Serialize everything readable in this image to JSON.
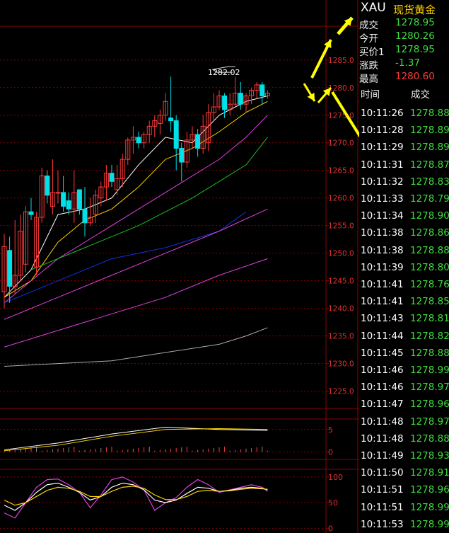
{
  "quote_panel": {
    "symbol": "XAU",
    "name": "现货黄金",
    "rows": [
      {
        "label": "成交",
        "value": "1278.95",
        "color": "green"
      },
      {
        "label": "今开",
        "value": "1280.26",
        "color": "green"
      },
      {
        "label": "买价1",
        "value": "1278.95",
        "color": "green"
      },
      {
        "label": "涨跌",
        "value": "-1.37",
        "color": "green"
      },
      {
        "label": "最高",
        "value": "1280.60",
        "color": "red"
      }
    ]
  },
  "ticks": {
    "header_time": "时间",
    "header_price": "成交",
    "rows": [
      {
        "time": "10:11:26",
        "price": "1278.88"
      },
      {
        "time": "10:11:28",
        "price": "1278.89"
      },
      {
        "time": "10:11:29",
        "price": "1278.89"
      },
      {
        "time": "10:11:31",
        "price": "1278.87"
      },
      {
        "time": "10:11:32",
        "price": "1278.83"
      },
      {
        "time": "10:11:33",
        "price": "1278.79"
      },
      {
        "time": "10:11:34",
        "price": "1278.90"
      },
      {
        "time": "10:11:38",
        "price": "1278.86"
      },
      {
        "time": "10:11:38",
        "price": "1278.88"
      },
      {
        "time": "10:11:39",
        "price": "1278.80"
      },
      {
        "time": "10:11:41",
        "price": "1278.76"
      },
      {
        "time": "10:11:41",
        "price": "1278.85"
      },
      {
        "time": "10:11:43",
        "price": "1278.81"
      },
      {
        "time": "10:11:44",
        "price": "1278.82"
      },
      {
        "time": "10:11:45",
        "price": "1278.88"
      },
      {
        "time": "10:11:46",
        "price": "1278.99"
      },
      {
        "time": "10:11:46",
        "price": "1278.97"
      },
      {
        "time": "10:11:47",
        "price": "1278.96"
      },
      {
        "time": "10:11:48",
        "price": "1278.97"
      },
      {
        "time": "10:11:48",
        "price": "1278.88"
      },
      {
        "time": "10:11:49",
        "price": "1278.93"
      },
      {
        "time": "10:11:50",
        "price": "1278.91"
      },
      {
        "time": "10:11:51",
        "price": "1278.96"
      },
      {
        "time": "10:11:51",
        "price": "1278.99"
      },
      {
        "time": "10:11:53",
        "price": "1278.99"
      }
    ]
  },
  "colors": {
    "up": "#ff3a3a",
    "down": "#00e0e8",
    "grid": "#8c0000",
    "axis_text": "#e03030",
    "ma5": "#ffffff",
    "ma10": "#ffd200",
    "ma20": "#e040e0",
    "ma30": "#20c020",
    "ma60": "#1030e0",
    "annotation_arrow": "#ffff00"
  },
  "chart_data": [
    {
      "type": "candlestick",
      "ylim": [
        1222,
        1291
      ],
      "y_tick_labels": [
        "1285.0",
        "1280.0",
        "1275.0",
        "1270.0",
        "1265.0",
        "1260.0",
        "1255.0",
        "1250.0",
        "1245.0",
        "1240.0",
        "1235.0",
        "1230.0",
        "1225.0"
      ],
      "y_ticks": [
        1285,
        1280,
        1275,
        1270,
        1265,
        1260,
        1255,
        1250,
        1245,
        1240,
        1235,
        1230,
        1225
      ],
      "high_label": "1282.02",
      "candles": [
        {
          "o": 1243,
          "h": 1253.5,
          "l": 1240,
          "c": 1251.2
        },
        {
          "o": 1250.5,
          "h": 1253,
          "l": 1241,
          "c": 1244
        },
        {
          "o": 1244,
          "h": 1256,
          "l": 1242.5,
          "c": 1246
        },
        {
          "o": 1246,
          "h": 1257,
          "l": 1245,
          "c": 1254
        },
        {
          "o": 1248,
          "h": 1258.5,
          "l": 1246.5,
          "c": 1257.5
        },
        {
          "o": 1257.5,
          "h": 1260,
          "l": 1256,
          "c": 1257
        },
        {
          "o": 1247.5,
          "h": 1257.5,
          "l": 1246,
          "c": 1256.5
        },
        {
          "o": 1256.5,
          "h": 1265.5,
          "l": 1255.5,
          "c": 1264
        },
        {
          "o": 1264,
          "h": 1265,
          "l": 1259,
          "c": 1260.5
        },
        {
          "o": 1258.5,
          "h": 1267,
          "l": 1257,
          "c": 1261
        },
        {
          "o": 1261,
          "h": 1265,
          "l": 1259,
          "c": 1261
        },
        {
          "o": 1261,
          "h": 1264,
          "l": 1257.5,
          "c": 1258.5
        },
        {
          "o": 1259.5,
          "h": 1261,
          "l": 1257,
          "c": 1258
        },
        {
          "o": 1258,
          "h": 1265,
          "l": 1255.5,
          "c": 1261
        },
        {
          "o": 1261.5,
          "h": 1261,
          "l": 1257,
          "c": 1258
        },
        {
          "o": 1258,
          "h": 1262,
          "l": 1253,
          "c": 1255.5
        },
        {
          "o": 1255.5,
          "h": 1260,
          "l": 1255,
          "c": 1256.5
        },
        {
          "o": 1257,
          "h": 1261.5,
          "l": 1255.5,
          "c": 1260.5
        },
        {
          "o": 1260,
          "h": 1263,
          "l": 1258.5,
          "c": 1262
        },
        {
          "o": 1262,
          "h": 1266,
          "l": 1259.5,
          "c": 1264.5
        },
        {
          "o": 1264.5,
          "h": 1266,
          "l": 1262,
          "c": 1263
        },
        {
          "o": 1261.5,
          "h": 1266,
          "l": 1260.5,
          "c": 1263.5
        },
        {
          "o": 1263.5,
          "h": 1268,
          "l": 1262,
          "c": 1267
        },
        {
          "o": 1267,
          "h": 1271,
          "l": 1266,
          "c": 1270.5
        },
        {
          "o": 1270.5,
          "h": 1273,
          "l": 1268,
          "c": 1271
        },
        {
          "o": 1271,
          "h": 1272,
          "l": 1269,
          "c": 1270
        },
        {
          "o": 1270,
          "h": 1272,
          "l": 1269,
          "c": 1271.5
        },
        {
          "o": 1271.5,
          "h": 1274,
          "l": 1270,
          "c": 1273
        },
        {
          "o": 1273,
          "h": 1275,
          "l": 1271,
          "c": 1274
        },
        {
          "o": 1273.5,
          "h": 1276,
          "l": 1271.5,
          "c": 1275
        },
        {
          "o": 1275,
          "h": 1279,
          "l": 1274,
          "c": 1277.5
        },
        {
          "o": 1274.5,
          "h": 1282,
          "l": 1272,
          "c": 1274
        },
        {
          "o": 1274,
          "h": 1275,
          "l": 1265,
          "c": 1269
        },
        {
          "o": 1269,
          "h": 1270,
          "l": 1263,
          "c": 1266.5
        },
        {
          "o": 1266.5,
          "h": 1272,
          "l": 1265.5,
          "c": 1270.5
        },
        {
          "o": 1270.5,
          "h": 1273,
          "l": 1269,
          "c": 1271.5
        },
        {
          "o": 1271.5,
          "h": 1272.5,
          "l": 1267.5,
          "c": 1269
        },
        {
          "o": 1269,
          "h": 1275,
          "l": 1268,
          "c": 1273
        },
        {
          "o": 1270,
          "h": 1277,
          "l": 1268.5,
          "c": 1275.5
        },
        {
          "o": 1275.5,
          "h": 1279,
          "l": 1274,
          "c": 1276.5
        },
        {
          "o": 1276.5,
          "h": 1279.5,
          "l": 1276,
          "c": 1278.5
        },
        {
          "o": 1278.5,
          "h": 1279,
          "l": 1274.5,
          "c": 1276
        },
        {
          "o": 1276,
          "h": 1279,
          "l": 1275,
          "c": 1277
        },
        {
          "o": 1277,
          "h": 1282,
          "l": 1276.5,
          "c": 1279
        },
        {
          "o": 1279,
          "h": 1281,
          "l": 1276,
          "c": 1277
        },
        {
          "o": 1277,
          "h": 1279,
          "l": 1275.5,
          "c": 1278.5
        },
        {
          "o": 1278.5,
          "h": 1280,
          "l": 1277,
          "c": 1279.5
        },
        {
          "o": 1279.5,
          "h": 1281,
          "l": 1278,
          "c": 1280.5
        },
        {
          "o": 1280.5,
          "h": 1281,
          "l": 1277,
          "c": 1278.5
        },
        {
          "o": 1278.5,
          "h": 1279.5,
          "l": 1278,
          "c": 1279
        }
      ],
      "moving_averages": [
        {
          "color": "ma5",
          "x": [
            0,
            5,
            10,
            15,
            20,
            25,
            30,
            35,
            40,
            45,
            49
          ],
          "y": [
            1242,
            1247,
            1257,
            1258,
            1260,
            1266,
            1271,
            1270,
            1275,
            1277.5,
            1278.5
          ]
        },
        {
          "color": "ma10",
          "x": [
            0,
            5,
            10,
            15,
            20,
            25,
            30,
            35,
            40,
            45,
            49
          ],
          "y": [
            1242,
            1245,
            1252,
            1256,
            1258,
            1262,
            1267,
            1269,
            1272,
            1275.5,
            1277.5
          ]
        },
        {
          "color": "ma20",
          "x": [
            0,
            10,
            20,
            30,
            40,
            45,
            49
          ],
          "y": [
            1241,
            1249,
            1255,
            1261,
            1267,
            1271,
            1275
          ]
        },
        {
          "color": "ma30",
          "x": [
            5,
            15,
            25,
            35,
            45,
            49
          ],
          "y": [
            1247,
            1251,
            1255,
            1260,
            1266,
            1271
          ]
        },
        {
          "color": "ma60",
          "x": [
            0,
            10,
            20,
            30,
            40,
            45
          ],
          "y": [
            1241,
            1245,
            1249,
            1251,
            1254,
            1257.5
          ]
        },
        {
          "color": "ma20",
          "x": [
            0,
            10,
            20,
            30,
            40,
            49
          ],
          "y": [
            1238,
            1242,
            1246,
            1250,
            1254,
            1258
          ]
        },
        {
          "color": "ma20",
          "x": [
            0,
            10,
            20,
            30,
            40,
            49
          ],
          "y": [
            1233,
            1236,
            1239,
            1242,
            1246,
            1249
          ]
        },
        {
          "color": "#aaaaaa",
          "x": [
            0,
            10,
            20,
            30,
            40,
            45,
            49
          ],
          "y": [
            1229.5,
            1230,
            1230.5,
            1232,
            1233.5,
            1235,
            1236.5
          ]
        }
      ]
    },
    {
      "type": "bar",
      "ylim": [
        -1,
        7
      ],
      "y_tick_labels": [
        "5",
        "0"
      ],
      "y_ticks": [
        5,
        0
      ],
      "series": [
        {
          "color": "#ffffff",
          "x": [
            0,
            10,
            20,
            30,
            40,
            49
          ],
          "y": [
            0.5,
            2,
            4,
            5.5,
            5,
            4.8
          ]
        },
        {
          "color": "#ffd200",
          "x": [
            0,
            10,
            20,
            30,
            40,
            49
          ],
          "y": [
            0.3,
            1.5,
            3.5,
            5,
            5.2,
            5
          ]
        }
      ]
    },
    {
      "type": "line",
      "ylim": [
        -5,
        115
      ],
      "y_tick_labels": [
        "100",
        "50",
        "0"
      ],
      "y_ticks": [
        100,
        50,
        0
      ],
      "series": [
        {
          "color": "ma20",
          "x": [
            0,
            2,
            4,
            6,
            8,
            10,
            12,
            14,
            16,
            18,
            20,
            22,
            24,
            26,
            28,
            30,
            32,
            34,
            36,
            38,
            40,
            42,
            44,
            46,
            48,
            49
          ],
          "y": [
            30,
            20,
            50,
            80,
            95,
            96,
            85,
            70,
            40,
            65,
            95,
            100,
            90,
            75,
            35,
            50,
            60,
            80,
            95,
            85,
            70,
            75,
            80,
            85,
            80,
            72
          ]
        },
        {
          "color": "ma5",
          "x": [
            0,
            2,
            4,
            6,
            8,
            10,
            12,
            14,
            16,
            18,
            20,
            22,
            24,
            26,
            28,
            30,
            32,
            34,
            36,
            38,
            40,
            42,
            44,
            46,
            48,
            49
          ],
          "y": [
            45,
            35,
            50,
            70,
            85,
            88,
            80,
            70,
            55,
            62,
            80,
            88,
            85,
            75,
            55,
            50,
            55,
            68,
            80,
            78,
            72,
            74,
            78,
            80,
            78,
            75
          ]
        },
        {
          "color": "ma10",
          "x": [
            0,
            2,
            4,
            6,
            8,
            10,
            12,
            14,
            16,
            18,
            20,
            22,
            24,
            26,
            28,
            30,
            32,
            34,
            36,
            38,
            40,
            42,
            44,
            46,
            48,
            49
          ],
          "y": [
            55,
            45,
            50,
            62,
            74,
            80,
            78,
            72,
            62,
            62,
            72,
            80,
            82,
            78,
            65,
            56,
            56,
            62,
            72,
            74,
            72,
            73,
            76,
            78,
            77,
            76
          ]
        }
      ]
    }
  ]
}
